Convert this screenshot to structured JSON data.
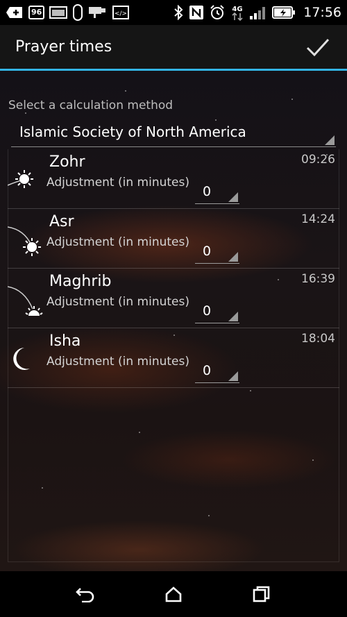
{
  "status_bar": {
    "battery_level": "96",
    "time": "17:56",
    "network": "4G",
    "icons": [
      "add-icon",
      "battery-saver-icon",
      "photo-icon",
      "phone-icon",
      "cast-icon",
      "code-icon",
      "bluetooth-icon",
      "nfc-icon",
      "alarm-icon",
      "network-4g-icon",
      "signal-icon",
      "battery-charging-icon"
    ]
  },
  "action_bar": {
    "title": "Prayer times",
    "confirm_icon": "check-icon",
    "accent_color": "#33b5e5"
  },
  "calculation": {
    "label": "Select a calculation method",
    "selected": "Islamic Society of North America"
  },
  "prayers": [
    {
      "name": "Zohr",
      "time": "09:26",
      "adjust_label": "Adjustment (in minutes)",
      "adjust_value": "0",
      "icon": "sun-high-icon"
    },
    {
      "name": "Asr",
      "time": "14:24",
      "adjust_label": "Adjustment (in minutes)",
      "adjust_value": "0",
      "icon": "sun-low-icon"
    },
    {
      "name": "Maghrib",
      "time": "16:39",
      "adjust_label": "Adjustment (in minutes)",
      "adjust_value": "0",
      "icon": "sunset-icon"
    },
    {
      "name": "Isha",
      "time": "18:04",
      "adjust_label": "Adjustment (in minutes)",
      "adjust_value": "0",
      "icon": "moon-icon"
    }
  ],
  "nav_bar": {
    "buttons": [
      "back-icon",
      "home-icon",
      "recents-icon"
    ]
  }
}
